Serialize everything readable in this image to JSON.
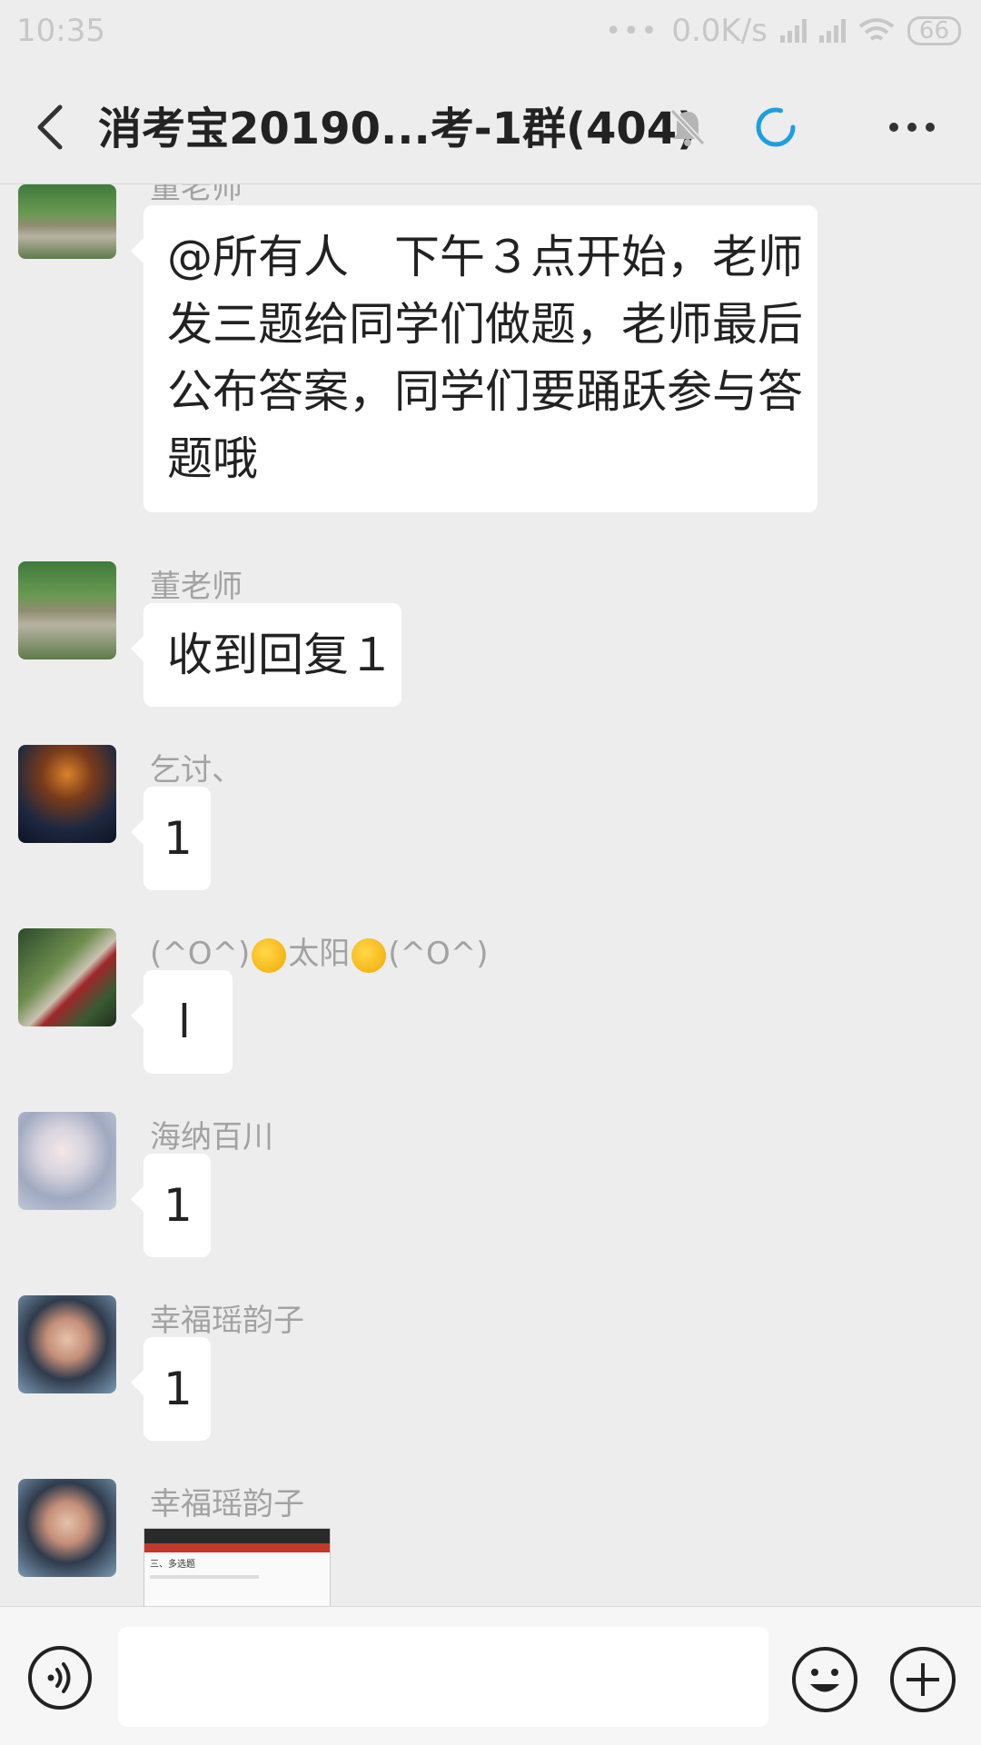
{
  "status_bar": {
    "time": "10:35",
    "dots": "•••",
    "network_speed": "0.0K/s",
    "battery": "66"
  },
  "header": {
    "back_icon": "chevron-left-icon",
    "title": "消考宝20190...考-1群(404)",
    "mute_icon": "bell-off-icon",
    "loading_icon": "spinner-icon",
    "more_icon": "ellipsis-icon"
  },
  "messages": [
    {
      "sender": "董老师",
      "text_lines": [
        "@所有人　下午３点开始，老师",
        "发三题给同学们做题，老师最后",
        "公布答案，同学们要踊跃参与答",
        "题哦"
      ]
    },
    {
      "sender": "董老师",
      "text": "收到回复１"
    },
    {
      "sender": "乞讨、",
      "text": "1"
    },
    {
      "sender_left": "(^O^)",
      "sender_mid": "太阳",
      "sender_right": "(^O^)",
      "text": "l"
    },
    {
      "sender": "海纳百川",
      "text": "1"
    },
    {
      "sender": "幸福瑶韵子",
      "text": "1"
    },
    {
      "sender": "幸福瑶韵子",
      "image_caption": "三、多选题"
    }
  ],
  "input_bar": {
    "voice_icon": "voice-icon",
    "message_placeholder": "",
    "emoji_icon": "smiley-icon",
    "plus_icon": "plus-icon"
  },
  "colors": {
    "background": "#ededed",
    "bubble": "#ffffff",
    "sender_text": "#a2a2a2",
    "spinner": "#1aa0e0"
  }
}
